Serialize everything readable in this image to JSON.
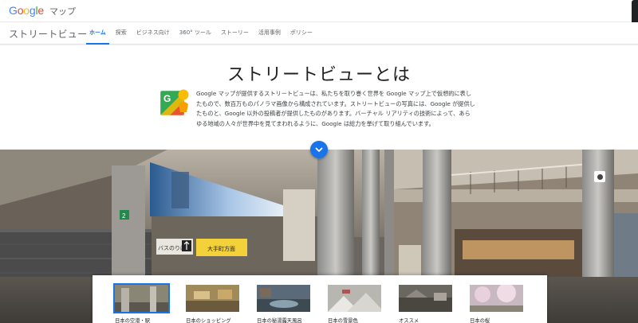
{
  "brand": {
    "logo_letters": [
      {
        "char": "G",
        "color": "#4285F4"
      },
      {
        "char": "o",
        "color": "#EA4335"
      },
      {
        "char": "o",
        "color": "#FBBC05"
      },
      {
        "char": "g",
        "color": "#4285F4"
      },
      {
        "char": "l",
        "color": "#34A853"
      },
      {
        "char": "e",
        "color": "#EA4335"
      }
    ],
    "product": "マップ"
  },
  "nav": {
    "title": "ストリートビュー",
    "tabs": [
      {
        "label": "ホーム",
        "active": true
      },
      {
        "label": "探索",
        "active": false
      },
      {
        "label": "ビジネス向け",
        "active": false
      },
      {
        "label": "360° ツール",
        "active": false
      },
      {
        "label": "ストーリー",
        "active": false
      },
      {
        "label": "活用事例",
        "active": false
      },
      {
        "label": "ポリシー",
        "active": false
      }
    ]
  },
  "hero": {
    "title": "ストリートビューとは",
    "logo_icon": "street-view-pegman-icon",
    "intro": "Google マップが提供するストリートビューは、私たちを取り巻く世界を Google マップ上で仮想的に表したもので、数百万ものパノラマ画像から構成されています。ストリートビューの写真には、Google が提供したものと、Google 以外の投稿者が提供したものがあります。バーチャル リアリティの技術によって、あらゆる地域の人々が世界中を見てまわれるように、Google は総力を挙げて取り組んでいます。"
  },
  "panorama": {
    "scroll_icon": "chevron-down-icon",
    "compass_icon": "compass-icon",
    "signs": [
      "バスのりば",
      "大手町方面"
    ]
  },
  "cards": [
    {
      "label": "日本の空港・駅",
      "selected": true,
      "tone": "#8a8676"
    },
    {
      "label": "日本のショッピング",
      "selected": false,
      "tone": "#a08a5a"
    },
    {
      "label": "日本の秘湯露天風呂",
      "selected": false,
      "tone": "#5a6a78"
    },
    {
      "label": "日本の雪景色",
      "selected": false,
      "tone": "#b8b6b0"
    },
    {
      "label": "オススメ",
      "selected": false,
      "tone": "#6a6660"
    },
    {
      "label": "日本の桜",
      "selected": false,
      "tone": "#c8b8c0"
    }
  ],
  "colors": {
    "accent": "#1a73e8",
    "text": "#202124",
    "muted": "#5f6368"
  }
}
